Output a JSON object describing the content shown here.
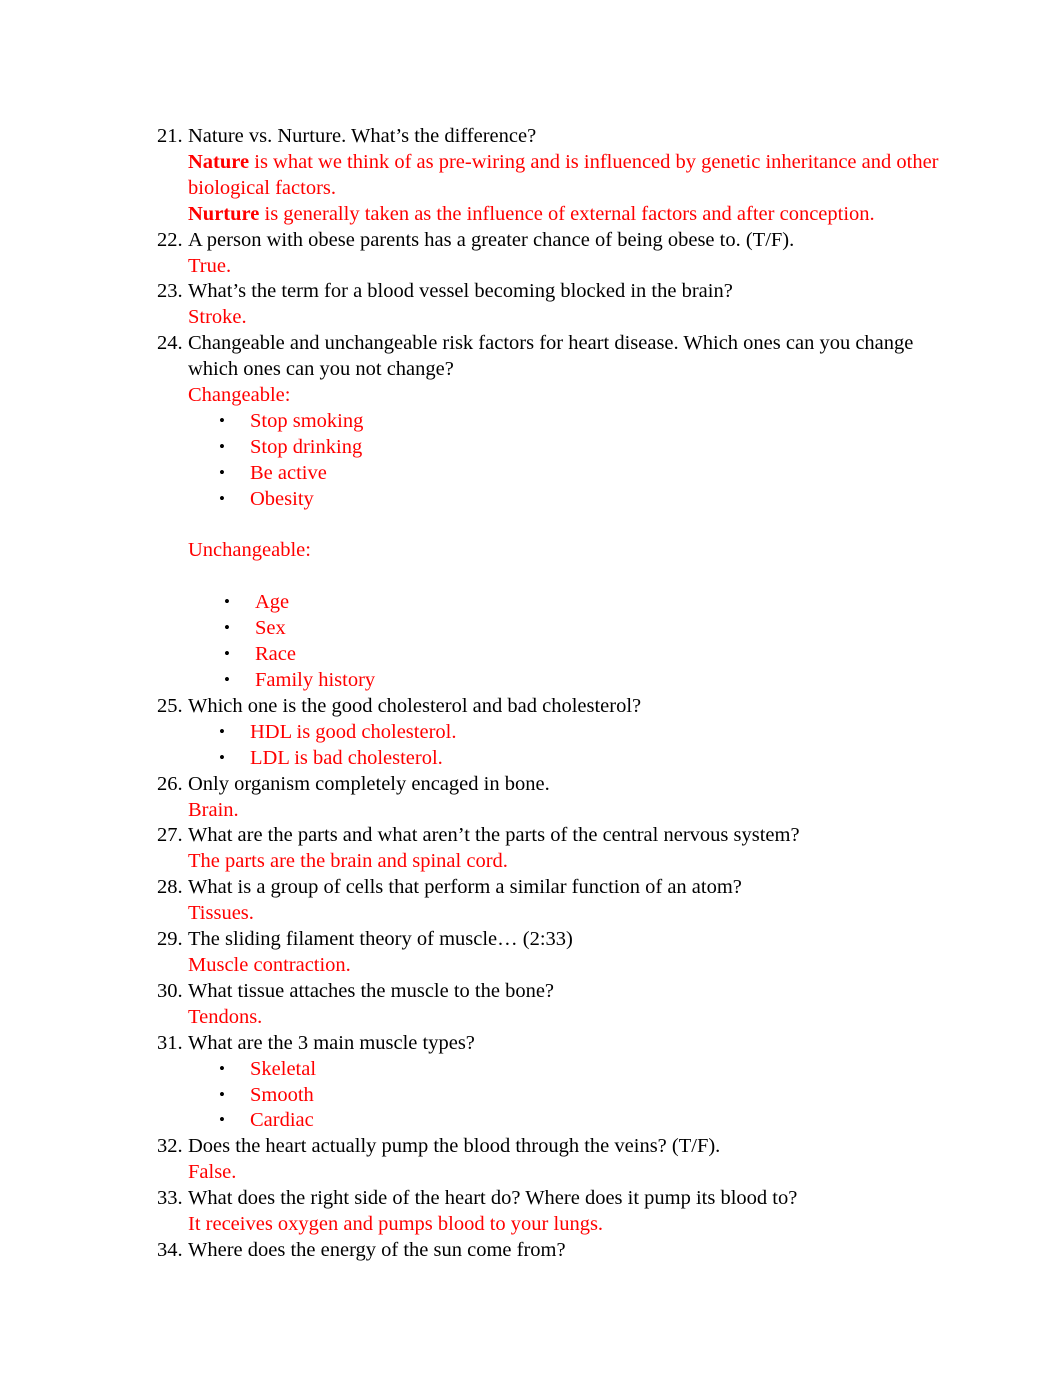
{
  "document": {
    "text_color": "#000000",
    "answer_color": "#FF0000",
    "items": [
      {
        "number": "21.",
        "question": "Nature vs. Nurture. What’s the difference?",
        "answer_lines": [
          {
            "bold": "Nature",
            "rest": " is what we think of as pre-wiring and is influenced by genetic inheritance and other biological factors."
          },
          {
            "bold": "Nurture",
            "rest": " is generally taken as the influence of external factors and after conception."
          }
        ]
      },
      {
        "number": "22.",
        "question": "A person with obese parents has a greater chance of being obese to. (T/F).",
        "answer": "True."
      },
      {
        "number": "23.",
        "question": "What’s the term for a blood vessel becoming blocked in the brain?",
        "answer": "Stroke."
      },
      {
        "number": "24.",
        "question": "Changeable and unchangeable risk factors for heart disease. Which ones can you change which ones can you not change?",
        "group_a_heading": "Changeable:",
        "group_a_items": [
          "Stop smoking",
          "Stop drinking",
          "Be active",
          "Obesity"
        ],
        "group_b_heading": "Unchangeable:",
        "group_b_items": [
          "Age",
          "Sex",
          "Race",
          "Family history"
        ]
      },
      {
        "number": "25.",
        "question": "Which one is the good cholesterol and bad cholesterol?",
        "bullets": [
          "HDL is good cholesterol.",
          "LDL is bad cholesterol."
        ]
      },
      {
        "number": "26.",
        "question": "Only organism completely encaged in bone.",
        "answer": "Brain."
      },
      {
        "number": "27.",
        "question": "What are the parts and what aren’t the parts of the central nervous system?",
        "answer": "The parts are the brain and spinal cord."
      },
      {
        "number": "28.",
        "question": "What is a group of cells that perform a similar function of an atom?",
        "answer": "Tissues."
      },
      {
        "number": "29.",
        "question": "The sliding filament theory of muscle… (2:33)",
        "answer": "Muscle contraction."
      },
      {
        "number": "30.",
        "question": "What tissue attaches the muscle to the bone?",
        "answer": "Tendons."
      },
      {
        "number": "31.",
        "question": "What are the 3 main muscle types?",
        "bullets": [
          "Skeletal",
          "Smooth",
          "Cardiac"
        ]
      },
      {
        "number": "32.",
        "question": "Does the heart actually pump the blood through the veins? (T/F).",
        "answer": "False."
      },
      {
        "number": "33.",
        "question": "What does the right side of the heart do? Where does it pump its blood to?",
        "answer": "It receives oxygen and pumps blood to your lungs."
      },
      {
        "number": "34.",
        "question": "Where does the energy of the sun come from?"
      }
    ]
  }
}
